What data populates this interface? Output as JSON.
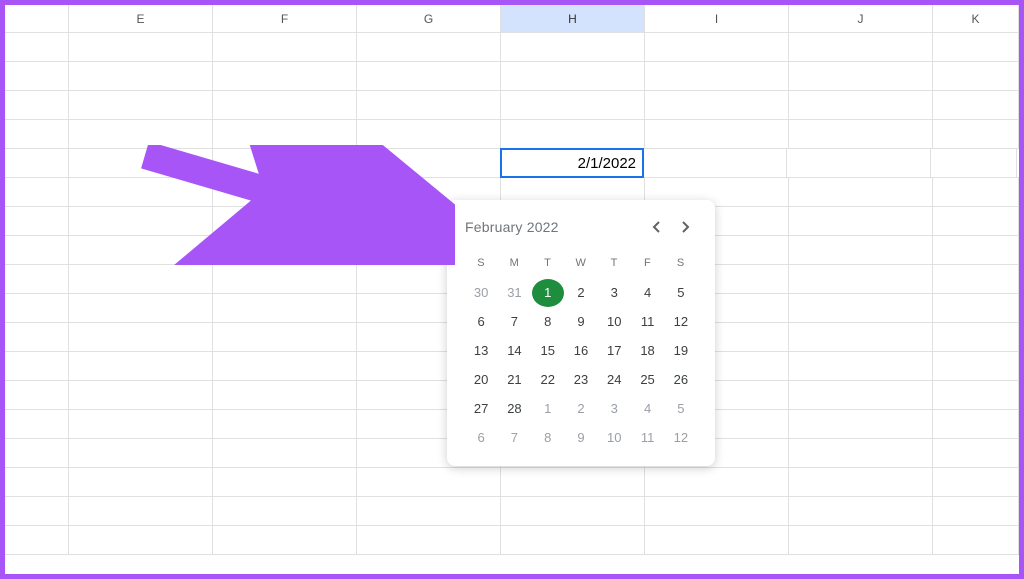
{
  "columns": [
    "",
    "E",
    "F",
    "G",
    "H",
    "I",
    "J",
    "K"
  ],
  "selectedColumn": "H",
  "selectedCell": {
    "value": "2/1/2022"
  },
  "datepicker": {
    "monthLabel": "February 2022",
    "dow": [
      "S",
      "M",
      "T",
      "W",
      "T",
      "F",
      "S"
    ],
    "days": [
      {
        "n": "30",
        "muted": true
      },
      {
        "n": "31",
        "muted": true
      },
      {
        "n": "1",
        "selected": true
      },
      {
        "n": "2"
      },
      {
        "n": "3"
      },
      {
        "n": "4"
      },
      {
        "n": "5"
      },
      {
        "n": "6"
      },
      {
        "n": "7"
      },
      {
        "n": "8"
      },
      {
        "n": "9"
      },
      {
        "n": "10"
      },
      {
        "n": "11"
      },
      {
        "n": "12"
      },
      {
        "n": "13"
      },
      {
        "n": "14"
      },
      {
        "n": "15"
      },
      {
        "n": "16"
      },
      {
        "n": "17"
      },
      {
        "n": "18"
      },
      {
        "n": "19"
      },
      {
        "n": "20"
      },
      {
        "n": "21"
      },
      {
        "n": "22"
      },
      {
        "n": "23"
      },
      {
        "n": "24"
      },
      {
        "n": "25"
      },
      {
        "n": "26"
      },
      {
        "n": "27"
      },
      {
        "n": "28"
      },
      {
        "n": "1",
        "muted": true
      },
      {
        "n": "2",
        "muted": true
      },
      {
        "n": "3",
        "muted": true
      },
      {
        "n": "4",
        "muted": true
      },
      {
        "n": "5",
        "muted": true
      },
      {
        "n": "6",
        "muted": true
      },
      {
        "n": "7",
        "muted": true
      },
      {
        "n": "8",
        "muted": true
      },
      {
        "n": "9",
        "muted": true
      },
      {
        "n": "10",
        "muted": true
      },
      {
        "n": "11",
        "muted": true
      },
      {
        "n": "12",
        "muted": true
      }
    ]
  },
  "colors": {
    "accent": "#a855f7",
    "selectedCellBorder": "#1a73e8",
    "selectedDayBg": "#1e8e3e"
  }
}
